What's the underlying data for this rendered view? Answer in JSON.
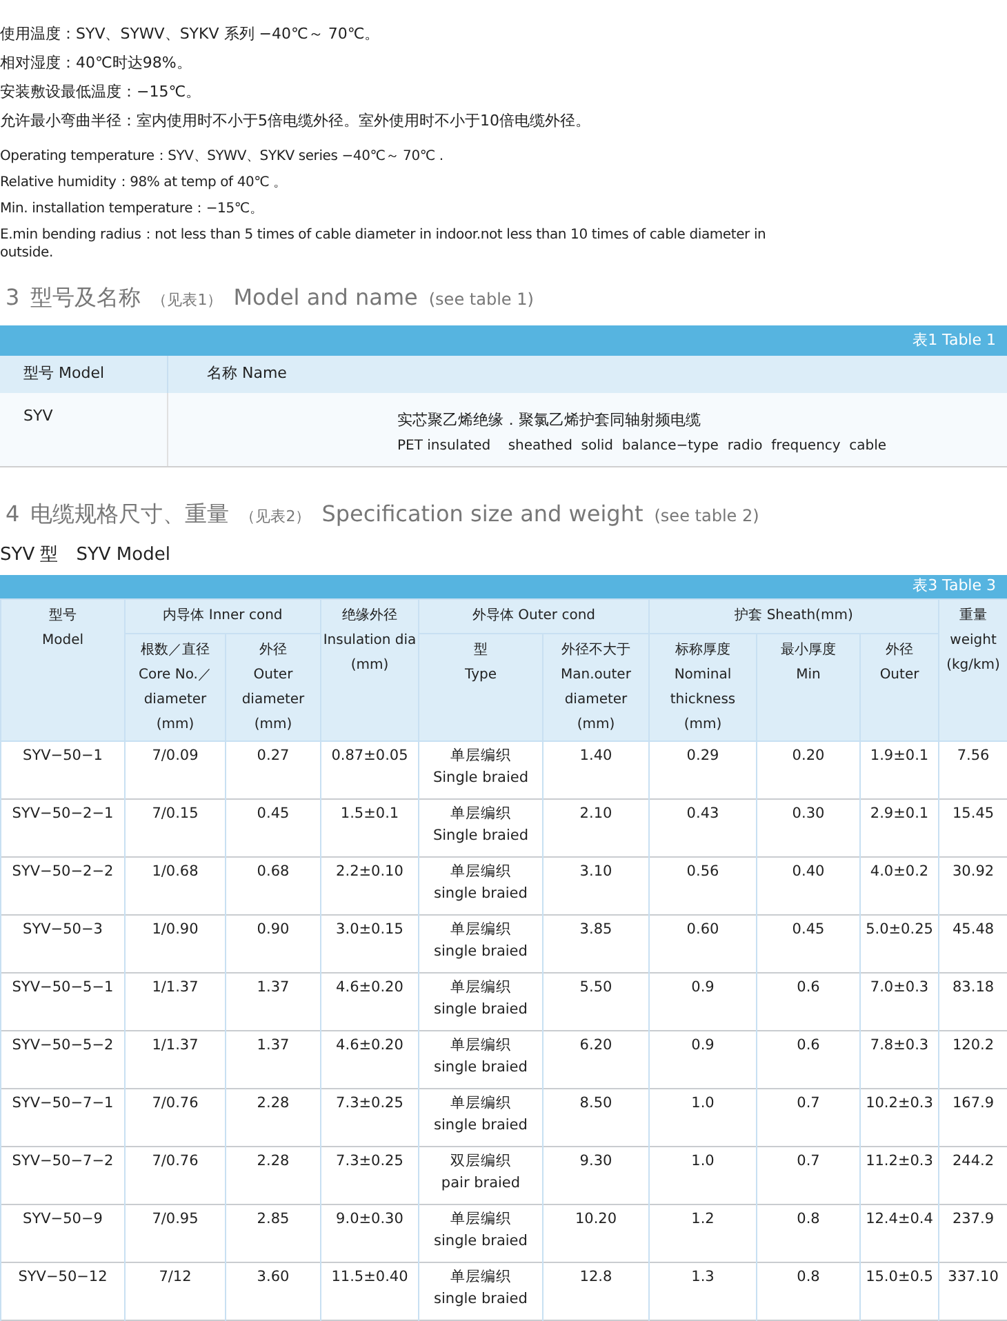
{
  "intro": {
    "zh_lines": [
      "使用温度：SYV、SYWV、SYKV 系列 −40℃～ 70℃。",
      "相对湿度：40℃时达98%。",
      "安装敷设最低温度：−15℃。",
      "允许最小弯曲半径：室内使用时不小于5倍电缆外径。室外使用时不小于10倍电缆外径。"
    ],
    "en_lines": [
      "Operating temperature：SYV、SYWV、SYKV series −40℃～ 70℃ .",
      "Relative humidity：98% at temp of 40℃ 。",
      "Min. installation temperature：−15℃。",
      "E.min bending radius：not less than 5  times of cable diameter in indoor.not less than 10 times of cable diameter in outside."
    ]
  },
  "section_3": {
    "number": "3",
    "title_zh": "型号及名称",
    "ref_zh": "（见表1）",
    "title_en": "Model and name",
    "ref_en": "(see table 1)"
  },
  "table_1": {
    "caption": "表1 Table 1",
    "columns": [
      "型号 Model",
      "名称 Name"
    ],
    "rows": [
      {
        "model": "SYV",
        "name_zh": "实芯聚乙烯绝缘．聚氯乙烯护套同轴射频电缆",
        "name_en": "PET insulated    sheathed  solid  balance−type  radio  frequency  cable"
      }
    ]
  },
  "section_4": {
    "number": "4",
    "title_zh": "电缆规格尺寸、重量",
    "ref_zh": "（见表2）",
    "title_en": "Specification size and weight",
    "ref_en": "(see table 2)"
  },
  "subtitle": "SYV 型　SYV Model",
  "table_3": {
    "caption": "表3 Table 3",
    "header_rows": [
      [
        {
          "lines": [
            "型号",
            "Model"
          ],
          "rowspan": 2
        },
        {
          "lines": [
            "内导体 Inner cond"
          ],
          "colspan": 2
        },
        {
          "lines": [
            "绝缘外径",
            "Insulation dia",
            "(mm)"
          ],
          "rowspan": 2
        },
        {
          "lines": [
            "外导体 Outer cond"
          ],
          "colspan": 2
        },
        {
          "lines": [
            "护套 Sheath(mm)"
          ],
          "colspan": 3
        },
        {
          "lines": [
            "重量",
            "weight",
            "(kg/km)"
          ],
          "rowspan": 2
        }
      ],
      [
        {
          "lines": [
            "根数／直径",
            "Core No.／",
            "diameter",
            "(mm)"
          ]
        },
        {
          "lines": [
            "外径",
            "Outer",
            "diameter",
            "(mm)"
          ]
        },
        {
          "lines": [
            "型",
            "Type"
          ]
        },
        {
          "lines": [
            "外径不大于",
            "Man.outer",
            "diameter",
            "(mm)"
          ]
        },
        {
          "lines": [
            "标称厚度",
            "Nominal",
            "thickness",
            "(mm)"
          ]
        },
        {
          "lines": [
            "最小厚度",
            "Min"
          ]
        },
        {
          "lines": [
            "外径",
            "Outer"
          ]
        }
      ]
    ],
    "rows": [
      {
        "cells": [
          [
            "SYV−50−1"
          ],
          [
            "7/0.09"
          ],
          [
            "0.27"
          ],
          [
            "0.87±0.05"
          ],
          [
            "单层编织",
            "Single braied"
          ],
          [
            "1.40"
          ],
          [
            "0.29"
          ],
          [
            "0.20"
          ],
          [
            "1.9±0.1"
          ],
          [
            "7.56"
          ]
        ]
      },
      {
        "cells": [
          [
            "SYV−50−2−1"
          ],
          [
            "7/0.15"
          ],
          [
            "0.45"
          ],
          [
            "1.5±0.1"
          ],
          [
            "单层编织",
            "Single braied"
          ],
          [
            "2.10"
          ],
          [
            "0.43"
          ],
          [
            "0.30"
          ],
          [
            "2.9±0.1"
          ],
          [
            "15.45"
          ]
        ]
      },
      {
        "cells": [
          [
            "SYV−50−2−2"
          ],
          [
            "1/0.68"
          ],
          [
            "0.68"
          ],
          [
            "2.2±0.10"
          ],
          [
            "单层编织",
            "single braied"
          ],
          [
            "3.10"
          ],
          [
            "0.56"
          ],
          [
            "0.40"
          ],
          [
            "4.0±0.2"
          ],
          [
            "30.92"
          ]
        ]
      },
      {
        "cells": [
          [
            "SYV−50−3"
          ],
          [
            "1/0.90"
          ],
          [
            "0.90"
          ],
          [
            "3.0±0.15"
          ],
          [
            "单层编织",
            "single braied"
          ],
          [
            "3.85"
          ],
          [
            "0.60"
          ],
          [
            "0.45"
          ],
          [
            "5.0±0.25"
          ],
          [
            "45.48"
          ]
        ]
      },
      {
        "cells": [
          [
            "SYV−50−5−1"
          ],
          [
            "1/1.37"
          ],
          [
            "1.37"
          ],
          [
            "4.6±0.20"
          ],
          [
            "单层编织",
            "single braied"
          ],
          [
            "5.50"
          ],
          [
            "0.9"
          ],
          [
            "0.6"
          ],
          [
            "7.0±0.3"
          ],
          [
            "83.18"
          ]
        ]
      },
      {
        "cells": [
          [
            "SYV−50−5−2"
          ],
          [
            "1/1.37"
          ],
          [
            "1.37"
          ],
          [
            "4.6±0.20"
          ],
          [
            "单层编织",
            "single braied"
          ],
          [
            "6.20"
          ],
          [
            "0.9"
          ],
          [
            "0.6"
          ],
          [
            "7.8±0.3"
          ],
          [
            "120.2"
          ]
        ]
      },
      {
        "cells": [
          [
            "SYV−50−7−1"
          ],
          [
            "7/0.76"
          ],
          [
            "2.28"
          ],
          [
            "7.3±0.25"
          ],
          [
            "单层编织",
            "single braied"
          ],
          [
            "8.50"
          ],
          [
            "1.0"
          ],
          [
            "0.7"
          ],
          [
            "10.2±0.3"
          ],
          [
            "167.9"
          ]
        ]
      },
      {
        "cells": [
          [
            "SYV−50−7−2"
          ],
          [
            "7/0.76"
          ],
          [
            "2.28"
          ],
          [
            "7.3±0.25"
          ],
          [
            "双层编织",
            "pair braied"
          ],
          [
            "9.30"
          ],
          [
            "1.0"
          ],
          [
            "0.7"
          ],
          [
            "11.2±0.3"
          ],
          [
            "244.2"
          ]
        ]
      },
      {
        "cells": [
          [
            "SYV−50−9"
          ],
          [
            "7/0.95"
          ],
          [
            "2.85"
          ],
          [
            "9.0±0.30"
          ],
          [
            "单层编织",
            "single braied"
          ],
          [
            "10.20"
          ],
          [
            "1.2"
          ],
          [
            "0.8"
          ],
          [
            "12.4±0.4"
          ],
          [
            "237.9"
          ]
        ]
      },
      {
        "cells": [
          [
            "SYV−50−12"
          ],
          [
            "7/12"
          ],
          [
            "3.60"
          ],
          [
            "11.5±0.40"
          ],
          [
            "单层编织",
            "single braied"
          ],
          [
            "12.8"
          ],
          [
            "1.3"
          ],
          [
            "0.8"
          ],
          [
            "15.0±0.5"
          ],
          [
            "337.10"
          ]
        ]
      }
    ]
  }
}
